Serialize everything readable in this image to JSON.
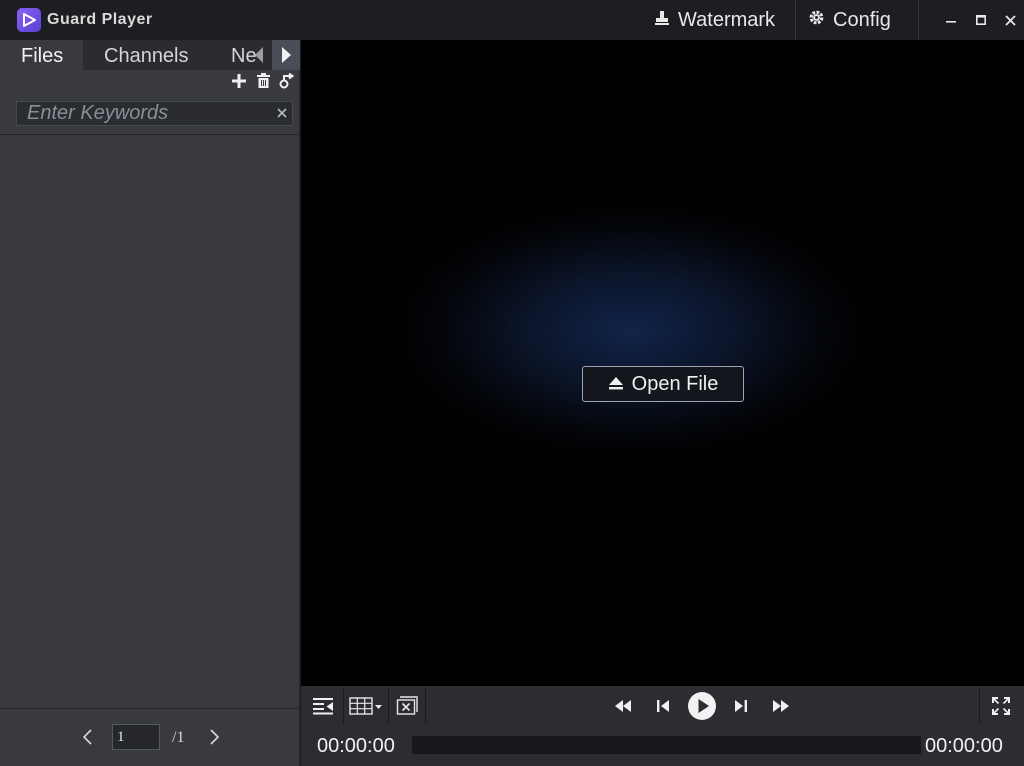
{
  "app": {
    "title": "Guard Player"
  },
  "titlebar": {
    "watermark_label": "Watermark",
    "config_label": "Config"
  },
  "sidebar": {
    "tabs": [
      {
        "label": "Files"
      },
      {
        "label": "Channels"
      },
      {
        "label": "Ne"
      }
    ],
    "search": {
      "placeholder": "Enter Keywords",
      "value": ""
    },
    "pager": {
      "current": "1",
      "total": "/1"
    }
  },
  "player": {
    "open_file_label": "Open File",
    "time_current": "00:00:00",
    "time_total": "00:00:00",
    "progress": 0
  },
  "colors": {
    "accent": "#7b5cf0",
    "sidebar_bg": "#383a40",
    "titlebar_bg": "#1d1e22",
    "controls_bg": "#2b2d33"
  },
  "icons": [
    "player-logo-icon",
    "stamp-icon",
    "gear-icon",
    "minimize-icon",
    "maximize-icon",
    "close-icon",
    "add-icon",
    "delete-icon",
    "rename-icon",
    "clear-icon",
    "chevron-left-icon",
    "chevron-right-icon",
    "eject-icon",
    "playlist-toggle-icon",
    "grid-layout-icon",
    "close-all-icon",
    "fast-backward-icon",
    "step-backward-icon",
    "play-icon",
    "step-forward-icon",
    "fast-forward-icon",
    "fullscreen-icon"
  ]
}
